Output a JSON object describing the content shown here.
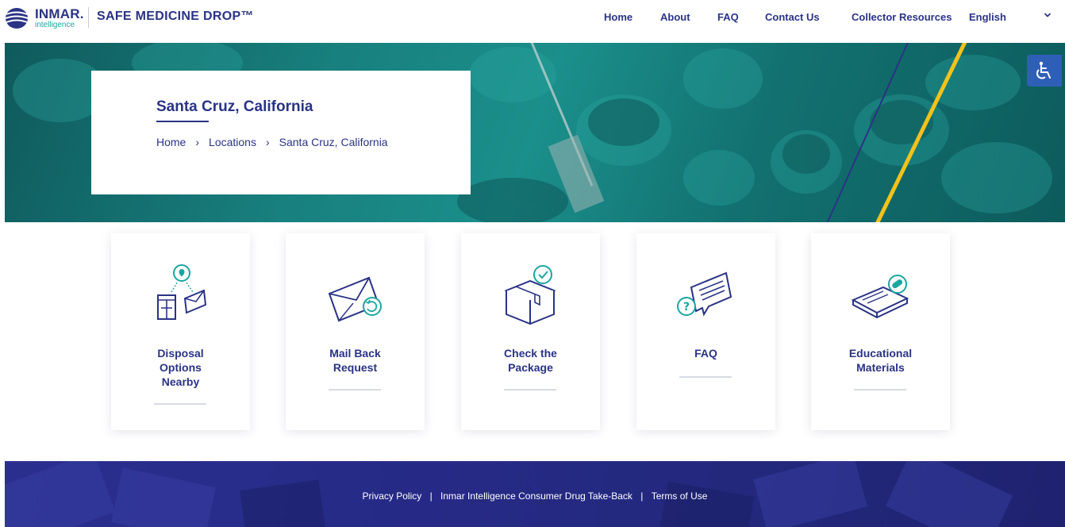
{
  "header": {
    "logo_word": "INMAR.",
    "logo_sub": "intelligence",
    "brand": "SAFE MEDICINE DROP™",
    "nav": [
      {
        "label": "Home"
      },
      {
        "label": "About"
      },
      {
        "label": "FAQ"
      },
      {
        "label": "Contact Us"
      },
      {
        "label": "Collector Resources"
      }
    ],
    "language": "English"
  },
  "hero": {
    "title": "Santa Cruz, California",
    "breadcrumb": [
      "Home",
      "Locations",
      "Santa Cruz, California"
    ],
    "breadcrumb_sep": "›"
  },
  "cards": [
    {
      "label": "Disposal Options Nearby",
      "icon": "location-mailbox-icon"
    },
    {
      "label": "Mail Back Request",
      "icon": "envelope-return-icon"
    },
    {
      "label": "Check the Package",
      "icon": "package-check-icon"
    },
    {
      "label": "FAQ",
      "icon": "question-chat-icon"
    },
    {
      "label": "Educational Materials",
      "icon": "book-pill-icon"
    }
  ],
  "footer": {
    "links": [
      "Privacy Policy",
      "Inmar Intelligence Consumer Drug Take-Back",
      "Terms of Use"
    ],
    "sep": "|"
  },
  "colors": {
    "brand_navy": "#2a3385",
    "teal_accent": "#1aa6a0",
    "hero_teal": "#18807e",
    "footer_blue": "#262a86",
    "accessibility_blue": "#2e5fb7",
    "stripe_yellow": "#f2c21b"
  }
}
